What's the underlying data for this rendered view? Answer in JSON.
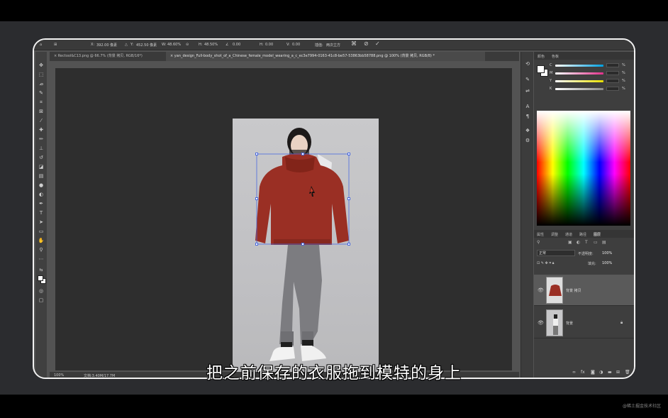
{
  "options_bar": {
    "x_label": "X:",
    "x_value": "392.00 像素",
    "y_label": "Y:",
    "y_value": "452.50 像素",
    "w_label": "W:",
    "w_value": "48.60%",
    "h_label": "H:",
    "h_value": "48.50%",
    "angle_value": "0.00",
    "hskew_label": "H:",
    "hskew_value": "0.00",
    "vskew_label": "V:",
    "vskew_value": "0.00",
    "interp_label": "插值:",
    "interp_value": "两次立方"
  },
  "tabs": [
    {
      "label": "Rectool&C13.png @ 66.7% (背景 拷贝, RGB/16*)",
      "close": "×"
    },
    {
      "label": "yan_design_Full-body_shot_of_a_Chinese_female_model_wearing_a_c_ec3e7994-0163-41c8-be57-53863bb58788.png @ 100% (背景 拷贝, RGB/8) *",
      "close": "×"
    }
  ],
  "status": {
    "zoom": "100%",
    "doc": "文档:3.40M/17.7M"
  },
  "color_panel": {
    "tabs": [
      "颜色",
      "色板"
    ],
    "sliders": [
      {
        "label": "C",
        "color": "#00a0e0",
        "value": ""
      },
      {
        "label": "M",
        "color": "#e0308a",
        "value": ""
      },
      {
        "label": "Y",
        "color": "#e8e000",
        "value": ""
      },
      {
        "label": "K",
        "color": "#888888",
        "value": ""
      }
    ],
    "pct": "%"
  },
  "layers_panel": {
    "tabs": [
      "属性",
      "调整",
      "通道",
      "路径",
      "图层"
    ],
    "blend_mode": "正常",
    "opacity_label": "不透明度:",
    "opacity_value": "100%",
    "fill_label": "填充:",
    "fill_value": "100%",
    "layers": [
      {
        "name": "背景 拷贝",
        "visible": true
      },
      {
        "name": "背景",
        "visible": true
      }
    ]
  },
  "subtitle": "把之前保存的衣服拖到模特的身上",
  "watermark": "@稀土掘金技术社区",
  "colors": {
    "hoodie": "#9a2f24",
    "canvas": "#2e2e2e",
    "accent": "#4a6ae0"
  }
}
